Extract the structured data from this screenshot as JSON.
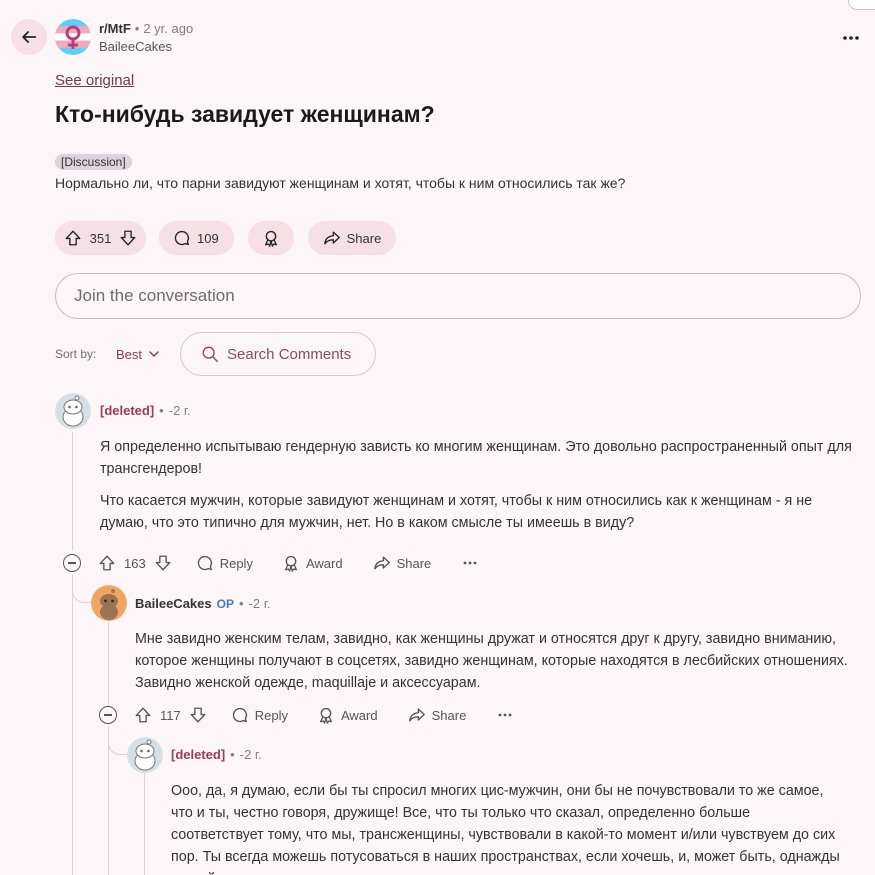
{
  "post": {
    "subreddit": "r/MtF",
    "age": "2 yr. ago",
    "author": "BaileeCakes",
    "see_original": "See original",
    "title": "Кто-нибудь завидует женщинам?",
    "flair": "[Discussion]",
    "body": "Нормально ли, что парни завидуют женщинам и хотят, чтобы к ним относились так же?",
    "votes": "351",
    "comments": "109",
    "share": "Share"
  },
  "join": {
    "placeholder": "Join the conversation"
  },
  "sort": {
    "label": "Sort by:",
    "value": "Best",
    "search": "Search Comments"
  },
  "comments": [
    {
      "author": "[deleted]",
      "age": "-2 г.",
      "paragraphs": [
        "Я определенно испытываю гендерную зависть ко многим женщинам. Это довольно распространенный опыт для трансгендеров!",
        "Что касается мужчин, которые завидуют женщинам и хотят, чтобы к ним относились как к женщинам - я не думаю, что это типично для мужчин, нет. Но в каком смысле ты имеешь в виду?"
      ],
      "votes": "163",
      "reply": "Reply",
      "award": "Award",
      "share": "Share"
    },
    {
      "author": "BaileeCakes",
      "op": "OP",
      "age": "-2 г.",
      "text": "Мне завидно женским телам, завидно, как женщины дружат и относятся друг к другу, завидно вниманию, которое женщины получают в соцсетях, завидно женщинам, которые находятся в лесбийских отношениях. Завидно женской одежде, maquillaje и аксессуарам.",
      "votes": "117",
      "reply": "Reply",
      "award": "Award",
      "share": "Share"
    },
    {
      "author": "[deleted]",
      "age": "-2 г.",
      "text": "Ооо, да, я думаю, если бы ты спросил многих цис-мужчин, они бы не почувствовали то же самое, что и ты, честно говоря, дружище! Все, что ты только что сказал, определенно больше соответствует тому, что мы, трансженщины, чувствовали в какой-то момент и/или чувствуем до сих пор. Ты всегда можешь потусоваться в наших пространствах, если хочешь, и, может быть, однажды ты поймешь, что ты тоже одна из нас."
    }
  ],
  "colors": {
    "accent": "#9b3a60",
    "pill_bg": "#f6e0e6",
    "page_bg": "#fcf6f8",
    "op": "#3a7ad0"
  }
}
